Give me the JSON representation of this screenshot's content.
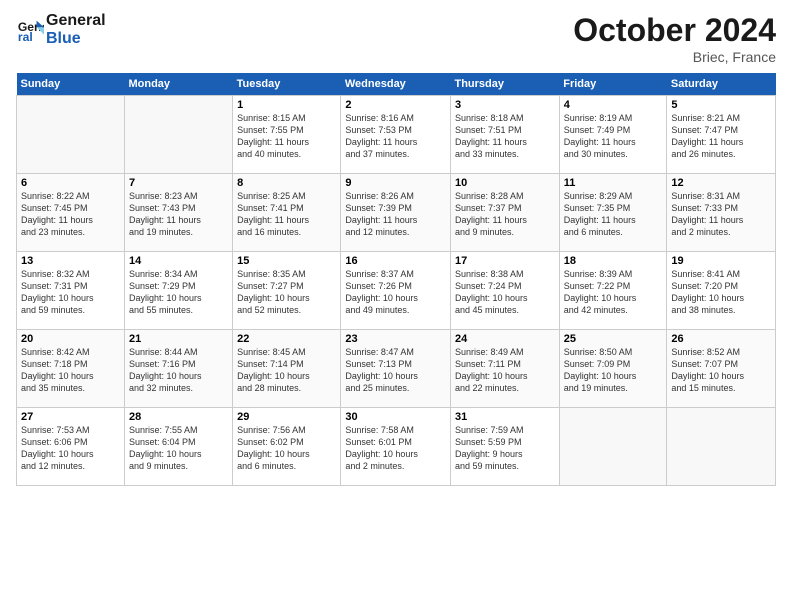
{
  "header": {
    "logo_line1": "General",
    "logo_line2": "Blue",
    "month": "October 2024",
    "location": "Briec, France"
  },
  "weekdays": [
    "Sunday",
    "Monday",
    "Tuesday",
    "Wednesday",
    "Thursday",
    "Friday",
    "Saturday"
  ],
  "weeks": [
    [
      {
        "day": "",
        "info": ""
      },
      {
        "day": "",
        "info": ""
      },
      {
        "day": "1",
        "info": "Sunrise: 8:15 AM\nSunset: 7:55 PM\nDaylight: 11 hours\nand 40 minutes."
      },
      {
        "day": "2",
        "info": "Sunrise: 8:16 AM\nSunset: 7:53 PM\nDaylight: 11 hours\nand 37 minutes."
      },
      {
        "day": "3",
        "info": "Sunrise: 8:18 AM\nSunset: 7:51 PM\nDaylight: 11 hours\nand 33 minutes."
      },
      {
        "day": "4",
        "info": "Sunrise: 8:19 AM\nSunset: 7:49 PM\nDaylight: 11 hours\nand 30 minutes."
      },
      {
        "day": "5",
        "info": "Sunrise: 8:21 AM\nSunset: 7:47 PM\nDaylight: 11 hours\nand 26 minutes."
      }
    ],
    [
      {
        "day": "6",
        "info": "Sunrise: 8:22 AM\nSunset: 7:45 PM\nDaylight: 11 hours\nand 23 minutes."
      },
      {
        "day": "7",
        "info": "Sunrise: 8:23 AM\nSunset: 7:43 PM\nDaylight: 11 hours\nand 19 minutes."
      },
      {
        "day": "8",
        "info": "Sunrise: 8:25 AM\nSunset: 7:41 PM\nDaylight: 11 hours\nand 16 minutes."
      },
      {
        "day": "9",
        "info": "Sunrise: 8:26 AM\nSunset: 7:39 PM\nDaylight: 11 hours\nand 12 minutes."
      },
      {
        "day": "10",
        "info": "Sunrise: 8:28 AM\nSunset: 7:37 PM\nDaylight: 11 hours\nand 9 minutes."
      },
      {
        "day": "11",
        "info": "Sunrise: 8:29 AM\nSunset: 7:35 PM\nDaylight: 11 hours\nand 6 minutes."
      },
      {
        "day": "12",
        "info": "Sunrise: 8:31 AM\nSunset: 7:33 PM\nDaylight: 11 hours\nand 2 minutes."
      }
    ],
    [
      {
        "day": "13",
        "info": "Sunrise: 8:32 AM\nSunset: 7:31 PM\nDaylight: 10 hours\nand 59 minutes."
      },
      {
        "day": "14",
        "info": "Sunrise: 8:34 AM\nSunset: 7:29 PM\nDaylight: 10 hours\nand 55 minutes."
      },
      {
        "day": "15",
        "info": "Sunrise: 8:35 AM\nSunset: 7:27 PM\nDaylight: 10 hours\nand 52 minutes."
      },
      {
        "day": "16",
        "info": "Sunrise: 8:37 AM\nSunset: 7:26 PM\nDaylight: 10 hours\nand 49 minutes."
      },
      {
        "day": "17",
        "info": "Sunrise: 8:38 AM\nSunset: 7:24 PM\nDaylight: 10 hours\nand 45 minutes."
      },
      {
        "day": "18",
        "info": "Sunrise: 8:39 AM\nSunset: 7:22 PM\nDaylight: 10 hours\nand 42 minutes."
      },
      {
        "day": "19",
        "info": "Sunrise: 8:41 AM\nSunset: 7:20 PM\nDaylight: 10 hours\nand 38 minutes."
      }
    ],
    [
      {
        "day": "20",
        "info": "Sunrise: 8:42 AM\nSunset: 7:18 PM\nDaylight: 10 hours\nand 35 minutes."
      },
      {
        "day": "21",
        "info": "Sunrise: 8:44 AM\nSunset: 7:16 PM\nDaylight: 10 hours\nand 32 minutes."
      },
      {
        "day": "22",
        "info": "Sunrise: 8:45 AM\nSunset: 7:14 PM\nDaylight: 10 hours\nand 28 minutes."
      },
      {
        "day": "23",
        "info": "Sunrise: 8:47 AM\nSunset: 7:13 PM\nDaylight: 10 hours\nand 25 minutes."
      },
      {
        "day": "24",
        "info": "Sunrise: 8:49 AM\nSunset: 7:11 PM\nDaylight: 10 hours\nand 22 minutes."
      },
      {
        "day": "25",
        "info": "Sunrise: 8:50 AM\nSunset: 7:09 PM\nDaylight: 10 hours\nand 19 minutes."
      },
      {
        "day": "26",
        "info": "Sunrise: 8:52 AM\nSunset: 7:07 PM\nDaylight: 10 hours\nand 15 minutes."
      }
    ],
    [
      {
        "day": "27",
        "info": "Sunrise: 7:53 AM\nSunset: 6:06 PM\nDaylight: 10 hours\nand 12 minutes."
      },
      {
        "day": "28",
        "info": "Sunrise: 7:55 AM\nSunset: 6:04 PM\nDaylight: 10 hours\nand 9 minutes."
      },
      {
        "day": "29",
        "info": "Sunrise: 7:56 AM\nSunset: 6:02 PM\nDaylight: 10 hours\nand 6 minutes."
      },
      {
        "day": "30",
        "info": "Sunrise: 7:58 AM\nSunset: 6:01 PM\nDaylight: 10 hours\nand 2 minutes."
      },
      {
        "day": "31",
        "info": "Sunrise: 7:59 AM\nSunset: 5:59 PM\nDaylight: 9 hours\nand 59 minutes."
      },
      {
        "day": "",
        "info": ""
      },
      {
        "day": "",
        "info": ""
      }
    ]
  ]
}
